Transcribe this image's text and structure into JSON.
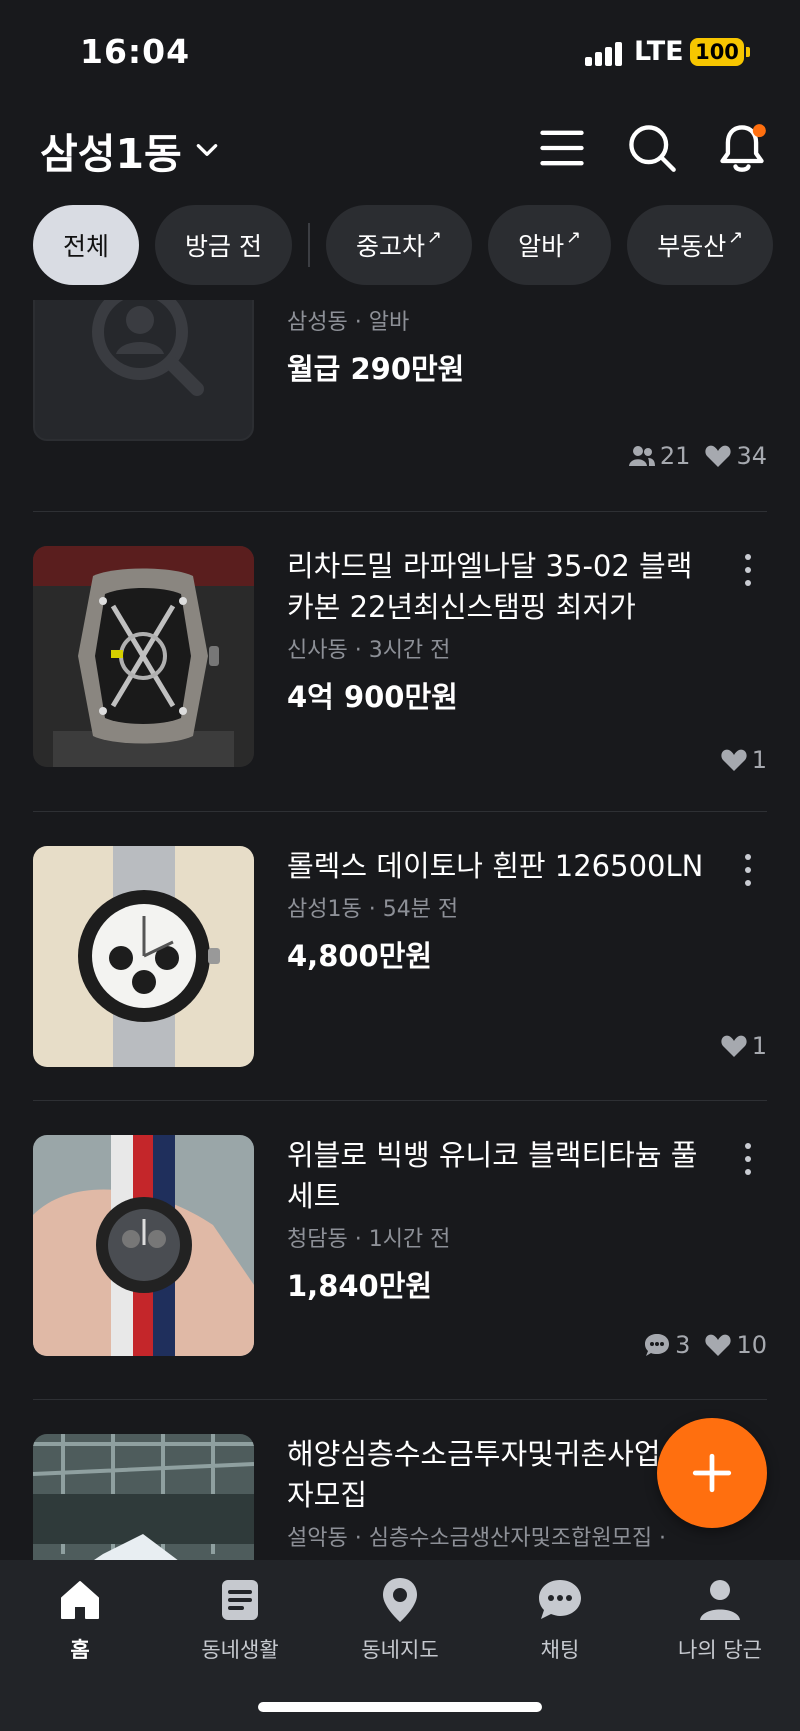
{
  "status_bar": {
    "time": "16:04",
    "network": "LTE",
    "battery": "100"
  },
  "header": {
    "location": "삼성1동"
  },
  "chips": [
    {
      "label": "전체",
      "active": true
    },
    {
      "label": "방금 전",
      "active": false
    },
    {
      "label": "중고차",
      "external": true
    },
    {
      "label": "알바",
      "external": true
    },
    {
      "label": "부동산",
      "external": true
    }
  ],
  "chip_arrow": "↗",
  "items": [
    {
      "title": "",
      "meta": "삼성동 · 알바",
      "price": "월급 290만원",
      "participants": "21",
      "likes": "34"
    },
    {
      "title": "리차드밀 라파엘나달 35-02 블랙 카본 22년최신스탬핑 최저가",
      "meta": "신사동 · 3시간 전",
      "price": "4억 900만원",
      "likes": "1"
    },
    {
      "title": "롤렉스 데이토나 흰판 126500LN",
      "meta": "삼성1동 · 54분 전",
      "price": "4,800만원",
      "likes": "1"
    },
    {
      "title": "위블로 빅뱅 유니코 블랙티타늄 풀세트",
      "meta": "청담동 · 1시간 전",
      "price": "1,840만원",
      "chats": "3",
      "likes": "10"
    },
    {
      "title": "해양심층수소금투자및귀촌사업생산자모집",
      "meta": "설악동 · 심층수소금생산자및조합원모집 ·"
    }
  ],
  "bottom_nav": [
    {
      "label": "홈",
      "icon": "home-icon",
      "active": true
    },
    {
      "label": "동네생활",
      "icon": "community-icon",
      "active": false
    },
    {
      "label": "동네지도",
      "icon": "map-pin-icon",
      "active": false
    },
    {
      "label": "채팅",
      "icon": "chat-icon",
      "active": false
    },
    {
      "label": "나의 당근",
      "icon": "profile-icon",
      "active": false
    }
  ],
  "colors": {
    "accent": "#ff6f0f",
    "background": "#18191c",
    "chip_active": "#d9dce3"
  }
}
